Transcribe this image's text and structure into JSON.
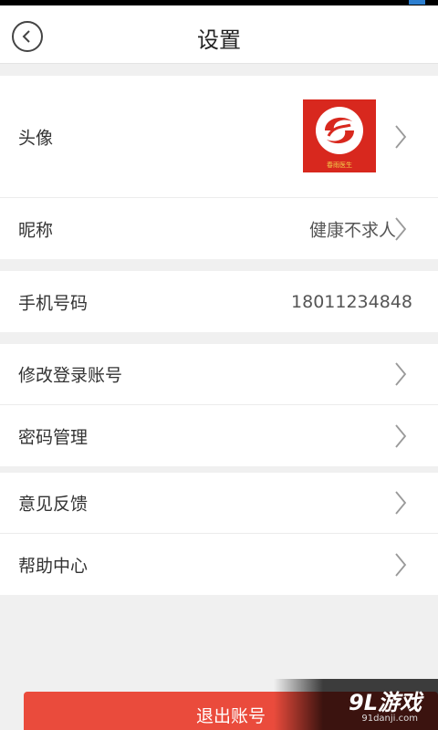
{
  "header": {
    "title": "设置",
    "back_icon": "chevron-left-circle-icon"
  },
  "profile": {
    "avatar_label": "头像",
    "avatar_caption": "春雨医生",
    "nickname_label": "昵称",
    "nickname_value": "健康不求人"
  },
  "phone": {
    "label": "手机号码",
    "value": "18011234848"
  },
  "account": {
    "change_login_label": "修改登录账号",
    "password_label": "密码管理"
  },
  "support": {
    "feedback_label": "意见反馈",
    "help_label": "帮助中心"
  },
  "logout": {
    "label": "退出账号"
  },
  "watermark": {
    "main": "9L游戏",
    "sub": "91danji.com"
  },
  "colors": {
    "accent": "#ea4b3c",
    "avatar_bg": "#d8281e",
    "background": "#f0f0f0"
  }
}
